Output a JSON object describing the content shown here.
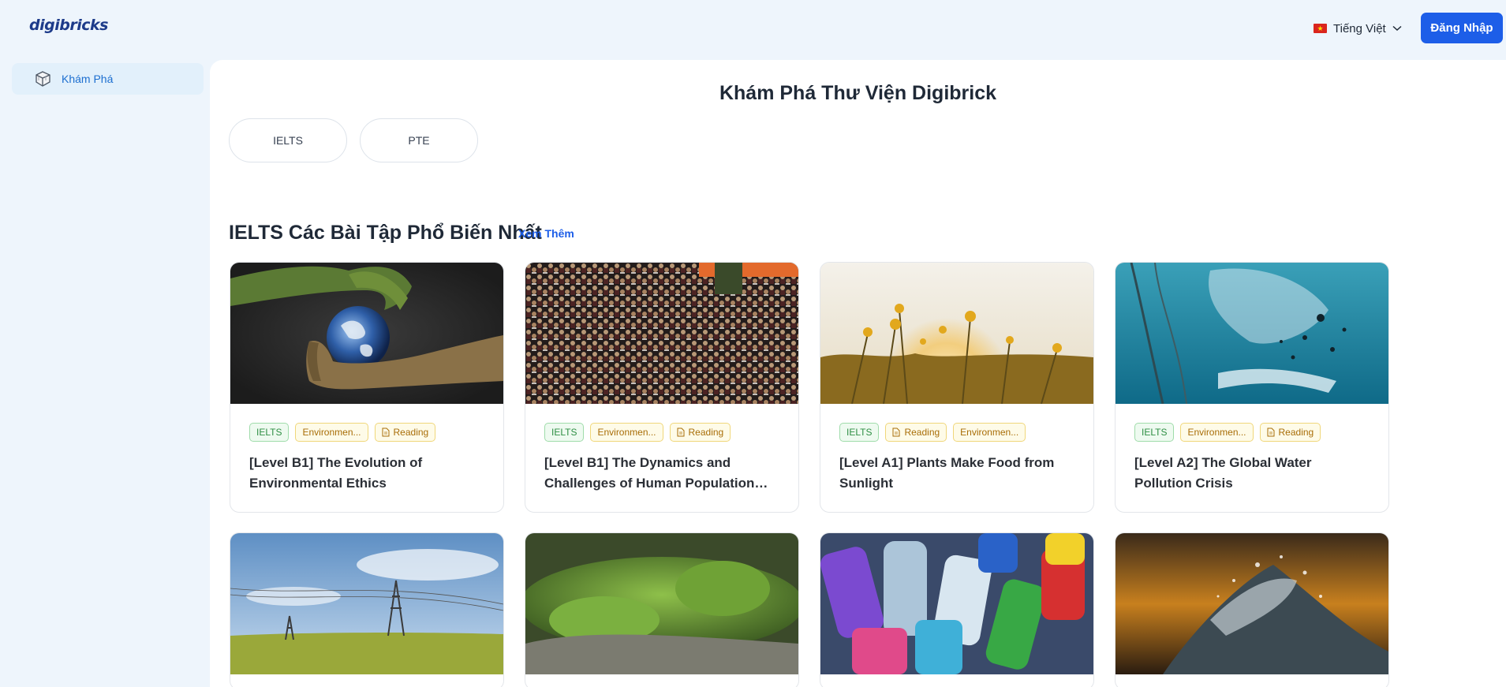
{
  "header": {
    "logo": "digibricks",
    "language": "Tiếng Việt",
    "login_label": "Đăng Nhập"
  },
  "sidebar": {
    "items": [
      {
        "label": "Khám Phá",
        "icon": "brick-cube-icon"
      }
    ]
  },
  "main": {
    "title": "Khám Phá Thư Viện Digibrick",
    "tabs": [
      {
        "label": "IELTS"
      },
      {
        "label": "PTE"
      }
    ],
    "section": {
      "title": "IELTS Các Bài Tập Phổ Biến Nhất",
      "see_more": "Xem Thêm"
    },
    "cards": [
      {
        "title": "[Level B1] The Evolution of Environmental Ethics",
        "image": "hands-holding-earth",
        "tags": [
          {
            "label": "IELTS",
            "style": "green"
          },
          {
            "label": "Environmen...",
            "style": "yellow"
          },
          {
            "label": "Reading",
            "style": "yellow",
            "icon": "document-icon"
          }
        ]
      },
      {
        "title": "[Level B1] The Dynamics and Challenges of Human Population…",
        "image": "crowd-of-people",
        "tags": [
          {
            "label": "IELTS",
            "style": "green"
          },
          {
            "label": "Environmen...",
            "style": "yellow"
          },
          {
            "label": "Reading",
            "style": "yellow",
            "icon": "document-icon"
          }
        ]
      },
      {
        "title": "[Level A1] Plants Make Food from Sunlight",
        "image": "flowers-in-sunlight",
        "tags": [
          {
            "label": "IELTS",
            "style": "green"
          },
          {
            "label": "Reading",
            "style": "yellow",
            "icon": "document-icon"
          },
          {
            "label": "Environmen...",
            "style": "yellow"
          }
        ]
      },
      {
        "title": "[Level A2] The Global Water Pollution Crisis",
        "image": "plastic-in-ocean",
        "tags": [
          {
            "label": "IELTS",
            "style": "green"
          },
          {
            "label": "Environmen...",
            "style": "yellow"
          },
          {
            "label": "Reading",
            "style": "yellow",
            "icon": "document-icon"
          }
        ]
      }
    ],
    "cards_row2_images": [
      "power-lines-field",
      "moss-closeup",
      "plastic-bottles",
      "water-splash"
    ]
  },
  "colors": {
    "accent": "#1d5ee8",
    "background": "#eef5fc",
    "tag_green": "#2f8f45",
    "tag_yellow": "#a86d07"
  }
}
